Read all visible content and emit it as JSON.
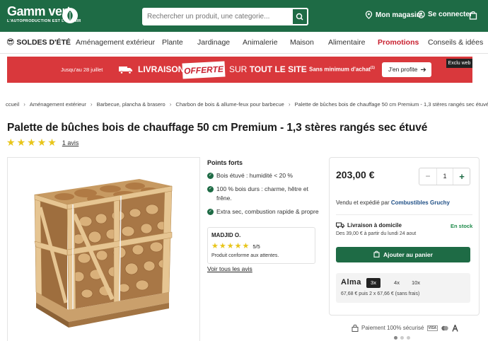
{
  "header": {
    "logo_text": "Gamm vert",
    "logo_tagline": "L'AUTOPRODUCTION EST L'AVENIR",
    "search_placeholder": "Rechercher un produit, une categorie...",
    "my_store": "Mon magasin",
    "login": "Se connecter"
  },
  "nav": {
    "soldes": "SOLDES D'ÉTÉ",
    "items": [
      "Aménagement extérieur",
      "Plante",
      "Jardinage",
      "Animalerie",
      "Maison",
      "Alimentaire"
    ],
    "promotions": "Promotions",
    "advice": "Conseils & idées"
  },
  "banner": {
    "date_text": "Jusqu'au 28 juillet",
    "livraison": "LIVRAISON",
    "offerte": "OFFERTE",
    "site_prefix": "SUR",
    "site_bold": "TOUT LE SITE",
    "minimum": "Sans minimum d'achat",
    "minimum_note": "(1)",
    "cta": "J'en profite",
    "exclu": "Exclu web"
  },
  "breadcrumb": [
    "ccueil",
    "Aménagement extérieur",
    "Barbecue, plancha & brasero",
    "Charbon de bois & allume-feux pour barbecue",
    "Palette de bûches bois de chauffage 50 cm Premium - 1,3 stères rangés sec étuvé"
  ],
  "product": {
    "title": "Palette de bûches bois de chauffage 50 cm Premium - 1,3 stères rangés sec étuvé",
    "rating": 5,
    "reviews_link": "1 avis"
  },
  "points_forts": {
    "title": "Points forts",
    "items": [
      "Bois étuvé : humidité < 20 %",
      "100 % bois durs : charme, hêtre et",
      "frêne.",
      "Extra sec, combustion rapide & propre"
    ]
  },
  "review": {
    "author": "MADJID O.",
    "score": "5/5",
    "stars": 5,
    "text": "Produit conforme aux attentes.",
    "all_reviews": "Voir tous les avis"
  },
  "buybox": {
    "price": "203,00 €",
    "quantity": "1",
    "seller_prefix": "Vendu et expédié par",
    "seller_name": "Combustibles Gruchy",
    "delivery_title": "Livraison à domicile",
    "delivery_stock": "En stock",
    "delivery_detail": "Des 39,00 € à partir du lundi 24 aout",
    "add_to_cart": "Ajouter au panier",
    "alma_brand": "Alma",
    "alma_options": [
      "3x",
      "4x",
      "10x"
    ],
    "alma_detail": "67,68 € puis 2 x 67,66 € (sans frais)"
  },
  "secure": {
    "text": "Paiement 100% sécurisé",
    "visa": "VISA"
  },
  "colors": {
    "brand_green": "#1e6b45",
    "promo_red": "#c8202f",
    "banner_red": "#d9383c",
    "star_yellow": "#e8c51a"
  }
}
